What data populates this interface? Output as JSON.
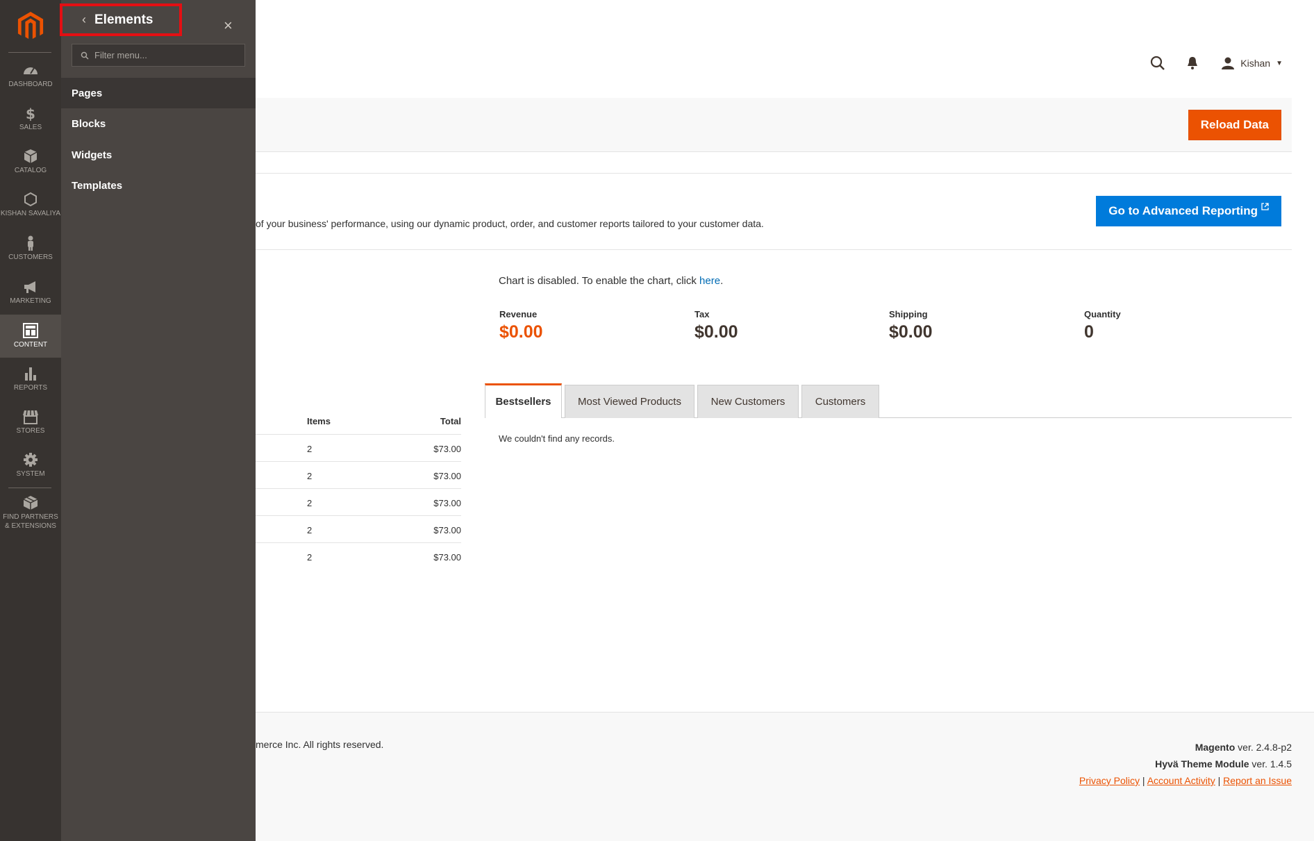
{
  "colors": {
    "accent": "#eb5202",
    "link_blue": "#007bdb",
    "nav_bg": "#373330",
    "panel_bg": "#4a4542",
    "highlight": "#e40f13"
  },
  "admin_nav": {
    "logo_icon": "magento-logo-icon",
    "items": [
      {
        "label": "DASHBOARD",
        "icon": "dashboard-icon"
      },
      {
        "label": "SALES",
        "icon": "dollar-icon"
      },
      {
        "label": "CATALOG",
        "icon": "box-icon"
      },
      {
        "label": "KISHAN SAVALIYA",
        "icon": "hexagon-icon"
      },
      {
        "label": "CUSTOMERS",
        "icon": "person-icon"
      },
      {
        "label": "MARKETING",
        "icon": "megaphone-icon"
      },
      {
        "label": "CONTENT",
        "icon": "layout-icon",
        "active": true
      },
      {
        "label": "REPORTS",
        "icon": "bar-chart-icon"
      },
      {
        "label": "STORES",
        "icon": "store-icon"
      },
      {
        "label": "SYSTEM",
        "icon": "gear-icon"
      },
      {
        "label": "FIND PARTNERS & EXTENSIONS",
        "icon": "cube-icon"
      }
    ]
  },
  "panel": {
    "title": "Elements",
    "filter_placeholder": "Filter menu...",
    "items": [
      {
        "label": "Pages",
        "active": true
      },
      {
        "label": "Blocks"
      },
      {
        "label": "Widgets"
      },
      {
        "label": "Templates"
      }
    ]
  },
  "header": {
    "user_name": "Kishan"
  },
  "toolbar": {
    "reload_label": "Reload Data"
  },
  "advanced": {
    "description": "of your business' performance, using our dynamic product, order, and customer reports tailored to your customer data.",
    "button_label": "Go to Advanced Reporting"
  },
  "chart_note": {
    "text": "Chart is disabled. To enable the chart, click ",
    "link": "here",
    "suffix": "."
  },
  "metrics": [
    {
      "label": "Revenue",
      "value": "$0.00"
    },
    {
      "label": "Tax",
      "value": "$0.00"
    },
    {
      "label": "Shipping",
      "value": "$0.00"
    },
    {
      "label": "Quantity",
      "value": "0"
    }
  ],
  "orders": {
    "columns": [
      "Items",
      "Total"
    ],
    "rows": [
      {
        "items": "2",
        "total": "$73.00"
      },
      {
        "items": "2",
        "total": "$73.00"
      },
      {
        "items": "2",
        "total": "$73.00"
      },
      {
        "items": "2",
        "total": "$73.00"
      },
      {
        "items": "2",
        "total": "$73.00"
      }
    ]
  },
  "tabs": [
    {
      "label": "Bestsellers",
      "active": true
    },
    {
      "label": "Most Viewed Products"
    },
    {
      "label": "New Customers"
    },
    {
      "label": "Customers"
    }
  ],
  "tab_content": {
    "empty_text": "We couldn't find any records."
  },
  "footer": {
    "copyright": "merce Inc. All rights reserved.",
    "magento_name": "Magento",
    "magento_ver": " ver. 2.4.8-p2",
    "hyva_name": "Hyvä Theme Module",
    "hyva_ver": " ver. 1.4.5",
    "links": [
      "Privacy Policy",
      "Account Activity",
      "Report an Issue"
    ]
  }
}
